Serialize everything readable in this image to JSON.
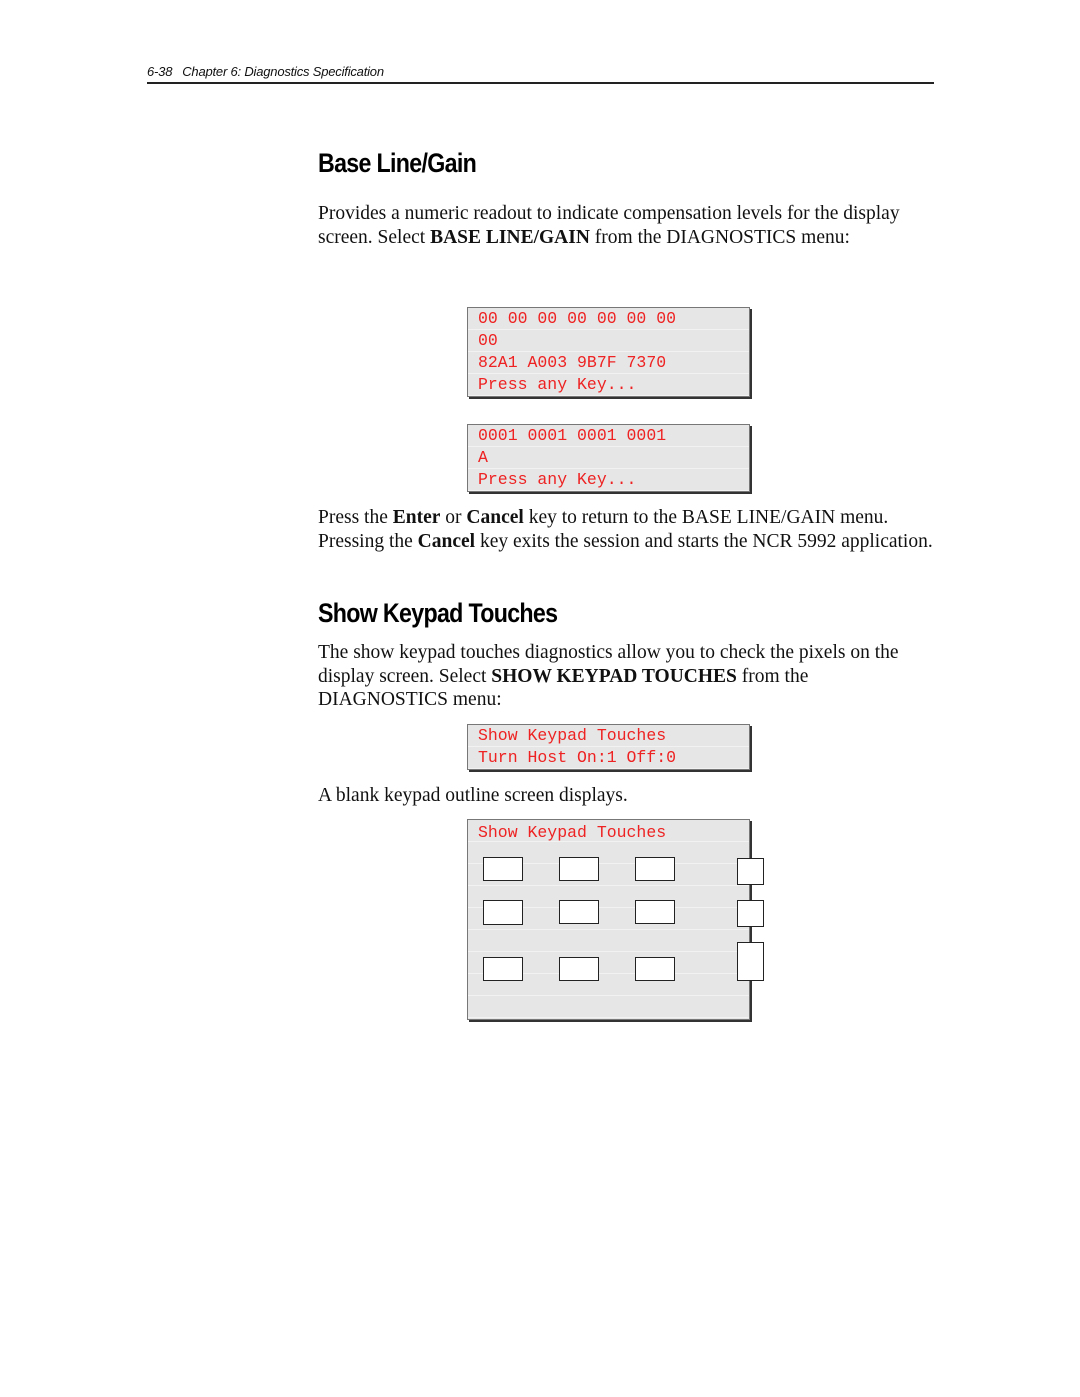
{
  "header": {
    "page_number": "6-38",
    "chapter_title": "Chapter 6: Diagnostics Specification"
  },
  "sections": [
    {
      "title": "Base Line/Gain",
      "intro": {
        "pre": "Provides a numeric readout to indicate compensation levels for the display screen. Select ",
        "bold": "BASE LINE/GAIN",
        "post": " from the DIAGNOSTICS menu:"
      },
      "screens": [
        {
          "lines": [
            "00 00 00 00 00 00 00",
            "00",
            "82A1 A003 9B7F 7370",
            "Press any Key..."
          ]
        },
        {
          "lines": [
            "0001 0001 0001 0001",
            "A",
            "Press any Key..."
          ]
        }
      ],
      "followup": {
        "t1": "Press the ",
        "b1": "Enter",
        "t2": " or ",
        "b2": "Cancel",
        "t3": " key to return to the BASE LINE/GAIN menu. Pressing the ",
        "b3": "Cancel",
        "t4": " key exits the session and starts the NCR 5992 application."
      }
    },
    {
      "title": "Show Keypad Touches",
      "intro": {
        "pre": "The show keypad touches diagnostics allow you to check the pixels on the display screen. Select ",
        "bold": "SHOW KEYPAD TOUCHES",
        "post": " from the DIAGNOSTICS menu:"
      },
      "screens": [
        {
          "lines": [
            "Show Keypad Touches",
            "Turn Host On:1 Off:0"
          ]
        }
      ],
      "caption": "A blank keypad outline screen displays.",
      "keypad_screen": {
        "title": "Show Keypad Touches",
        "grid_rows": 3,
        "grid_cols": 3,
        "side_keys": 3
      }
    }
  ],
  "colors": {
    "lcd_text": "#ee2222",
    "lcd_background": "#e6e6e6"
  }
}
